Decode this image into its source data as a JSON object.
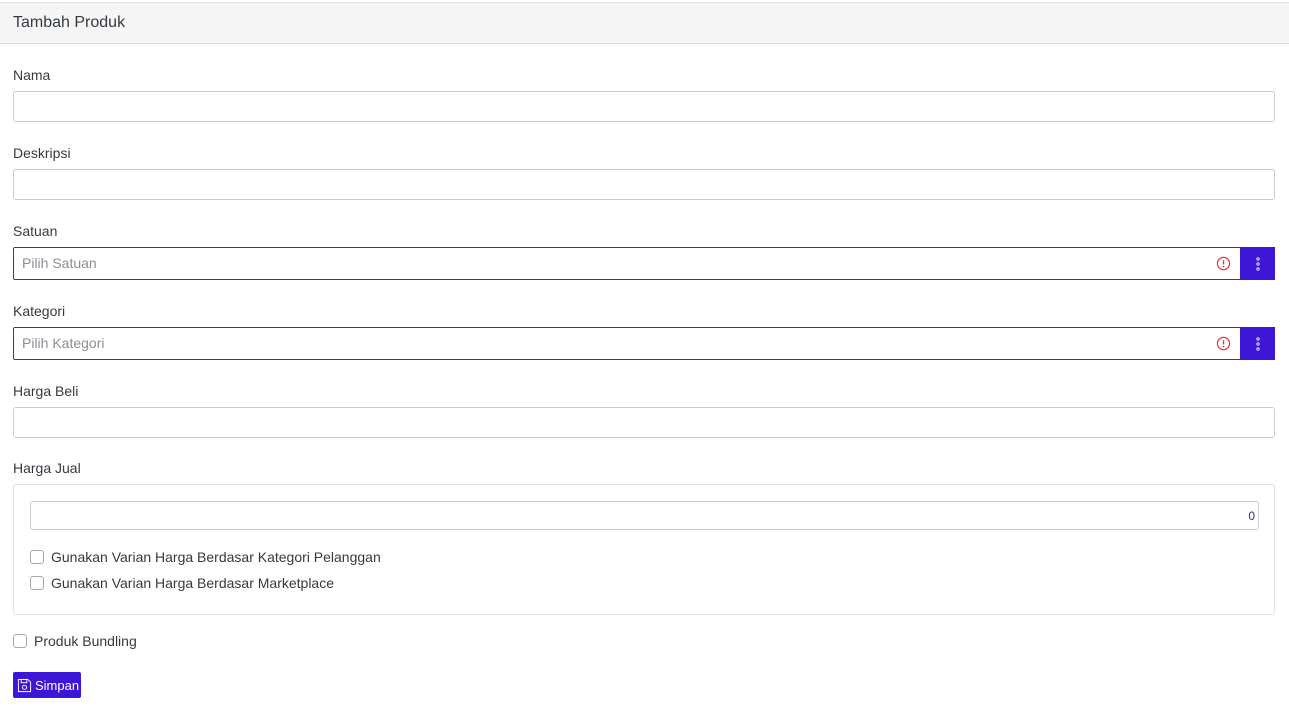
{
  "header": {
    "title": "Tambah Produk"
  },
  "form": {
    "nama_label": "Nama",
    "deskripsi_label": "Deskripsi",
    "satuan_label": "Satuan",
    "satuan_placeholder": "Pilih Satuan",
    "kategori_label": "Kategori",
    "kategori_placeholder": "Pilih Kategori",
    "harga_beli_label": "Harga Beli",
    "harga_jual_label": "Harga Jual",
    "harga_jual_value": "0",
    "varian_pelanggan_label": "Gunakan Varian Harga Berdasar Kategori Pelanggan",
    "varian_marketplace_label": "Gunakan Varian Harga Berdasar Marketplace",
    "bundling_label": "Produk Bundling",
    "save_label": "Simpan"
  },
  "colors": {
    "accent": "#3e16d8",
    "error": "#dc3545",
    "select_border": "#7b1a7d"
  },
  "icons": {
    "select_error": "alert-circle-icon",
    "select_button": "more-vertical-icon",
    "save": "save-icon"
  }
}
